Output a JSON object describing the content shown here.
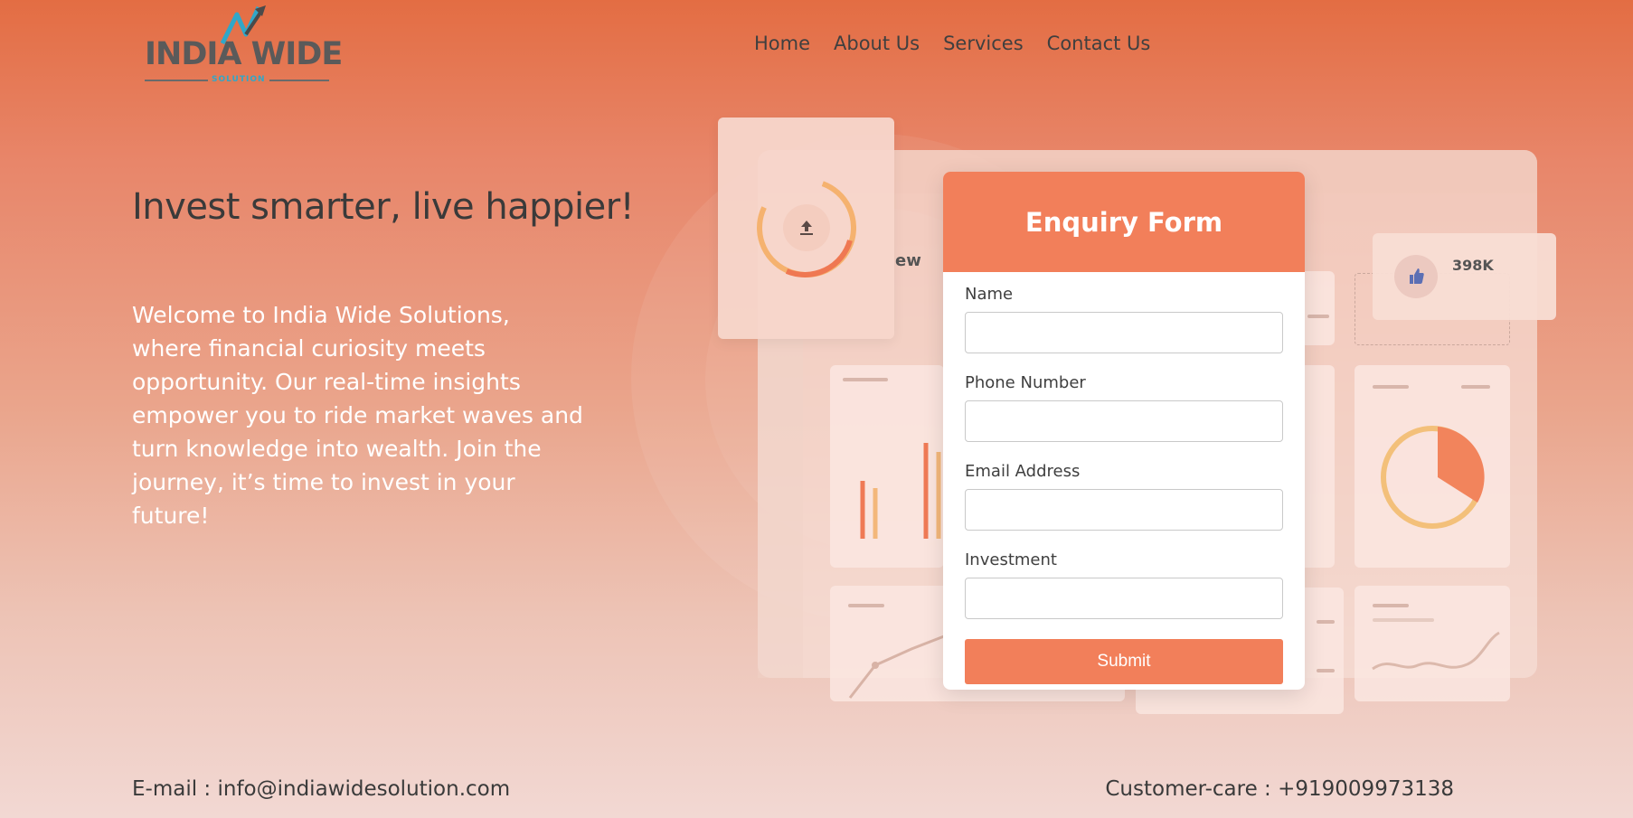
{
  "logo": {
    "text": "INDIA WIDE",
    "sub": "SOLUTION"
  },
  "nav": {
    "items": [
      "Home",
      "About Us",
      "Services",
      "Contact Us"
    ]
  },
  "hero": {
    "headline": "Invest smarter, live happier!",
    "intro": "Welcome to India Wide Solutions, where financial curiosity meets opportunity. Our real-time insights empower you to ride market waves and turn knowledge into wealth. Join the journey, it’s time to invest in your future!"
  },
  "illustration": {
    "likes_count": "398K",
    "partial_label": "ew"
  },
  "form": {
    "title": "Enquiry Form",
    "fields": [
      {
        "label": "Name",
        "value": ""
      },
      {
        "label": "Phone Number",
        "value": ""
      },
      {
        "label": "Email Address",
        "value": ""
      },
      {
        "label": "Investment",
        "value": ""
      }
    ],
    "submit_label": "Submit"
  },
  "footer": {
    "email": "E-mail : info@indiawidesolution.com",
    "phone": "Customer-care : +919009973138"
  },
  "colors": {
    "accent": "#f27f5a",
    "header_bg": "#e36d43",
    "logo_blue": "#30a7c9"
  }
}
